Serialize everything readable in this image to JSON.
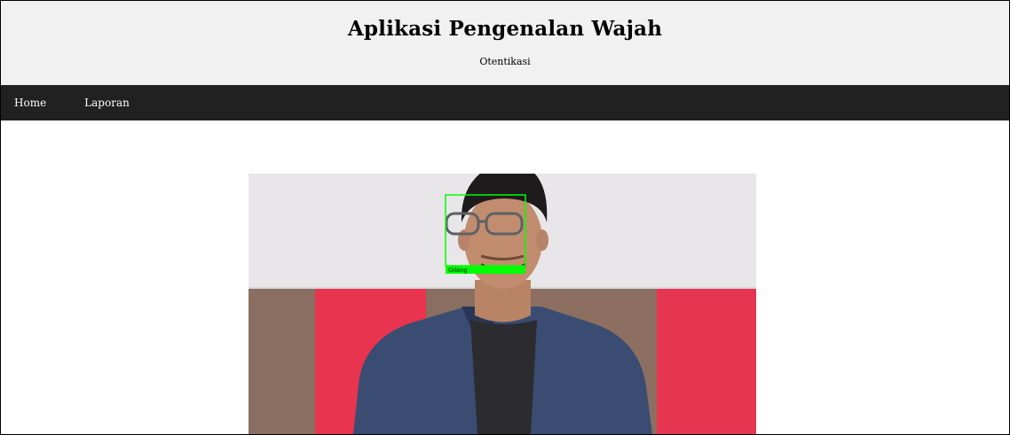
{
  "header": {
    "title": "Aplikasi Pengenalan Wajah",
    "subtitle": "Otentikasi"
  },
  "nav": {
    "items": [
      {
        "label": "Home"
      },
      {
        "label": "Laporan"
      }
    ]
  },
  "recognition": {
    "detected_name": "Gilang",
    "box_color": "#00ff00"
  },
  "colors": {
    "header_bg": "#f1f1f1",
    "nav_bg": "#212121",
    "nav_text": "#ffffff"
  }
}
